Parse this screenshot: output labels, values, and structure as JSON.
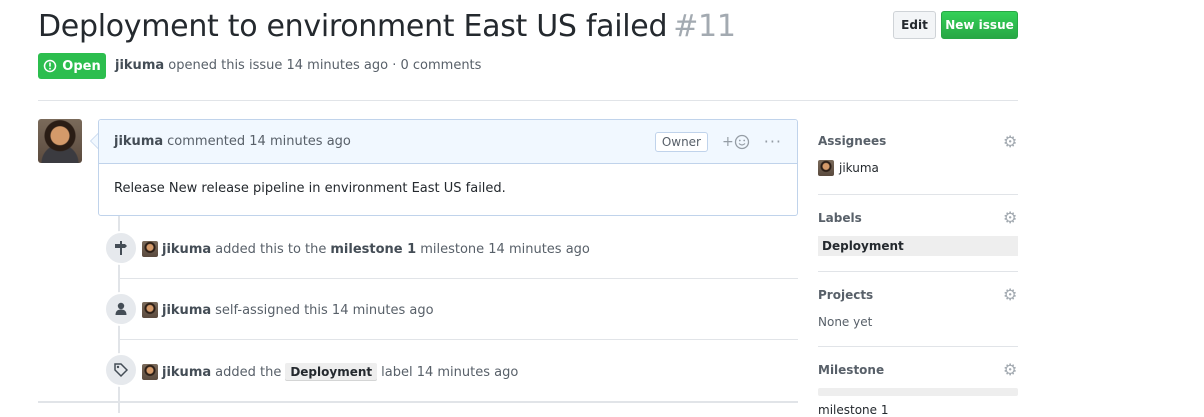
{
  "issue": {
    "title": "Deployment to environment East US failed",
    "number": "#11",
    "state": "Open",
    "author": "jikuma",
    "opened_text": "opened this issue 14 minutes ago · 0 comments"
  },
  "header": {
    "edit_label": "Edit",
    "new_issue_label": "New issue"
  },
  "comment": {
    "author": "jikuma",
    "meta": "commented 14 minutes ago",
    "role": "Owner",
    "reaction_label": "+",
    "more_label": "···",
    "body": "Release New release pipeline in environment East US failed."
  },
  "events": [
    {
      "icon": "milestone-icon",
      "user": "jikuma",
      "text_pre": "added this to the",
      "bold": "milestone 1",
      "text_post": "milestone 14 minutes ago"
    },
    {
      "icon": "person-icon",
      "user": "jikuma",
      "text_pre": "self-assigned this 14 minutes ago"
    },
    {
      "icon": "tag-icon",
      "user": "jikuma",
      "text_pre": "added the",
      "label": "Deployment",
      "text_post": "label 14 minutes ago"
    }
  ],
  "sidebar": {
    "assignees": {
      "title": "Assignees",
      "value": "jikuma"
    },
    "labels": {
      "title": "Labels",
      "value": "Deployment"
    },
    "projects": {
      "title": "Projects",
      "value": "None yet"
    },
    "milestone": {
      "title": "Milestone",
      "value": "milestone 1"
    }
  },
  "colors": {
    "open_green": "#2cbe4e",
    "comment_border": "#c0d3eb",
    "comment_header": "#f1f8ff"
  }
}
